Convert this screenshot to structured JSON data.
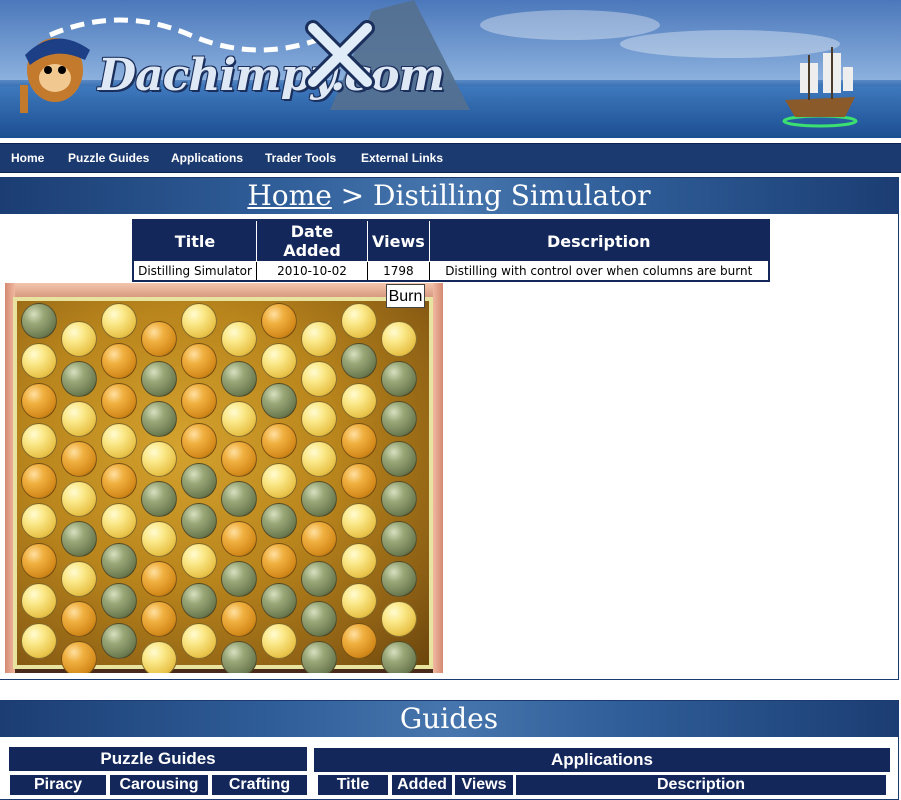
{
  "site": {
    "logo_text": "Dachimpy.com"
  },
  "nav": {
    "items": [
      "Home",
      "Puzzle Guides",
      "Applications",
      "Trader Tools",
      "External Links"
    ]
  },
  "page": {
    "breadcrumb_home": "Home",
    "breadcrumb_sep": " > ",
    "breadcrumb_current": "Distilling Simulator"
  },
  "info_table": {
    "headers": [
      "Title",
      "Date Added",
      "Views",
      "Description"
    ],
    "row": [
      "Distilling Simulator",
      "2010-10-02",
      "1798",
      "Distilling with control over when columns are burnt"
    ]
  },
  "game": {
    "burn_label": "Burn",
    "grid": [
      [
        "green",
        "yellow",
        "yellow",
        "orange",
        "yellow",
        "yellow",
        "orange",
        "yellow",
        "yellow",
        "yellow"
      ],
      [
        "yellow",
        "green",
        "orange",
        "green",
        "orange",
        "green",
        "yellow",
        "yellow",
        "green",
        "green"
      ],
      [
        "orange",
        "yellow",
        "orange",
        "green",
        "orange",
        "yellow",
        "green",
        "yellow",
        "yellow",
        "green"
      ],
      [
        "yellow",
        "orange",
        "yellow",
        "yellow",
        "orange",
        "orange",
        "orange",
        "yellow",
        "orange",
        "green"
      ],
      [
        "orange",
        "yellow",
        "orange",
        "green",
        "green",
        "green",
        "yellow",
        "green",
        "orange",
        "green"
      ],
      [
        "yellow",
        "green",
        "yellow",
        "yellow",
        "green",
        "orange",
        "green",
        "orange",
        "yellow",
        "green"
      ],
      [
        "orange",
        "yellow",
        "green",
        "orange",
        "yellow",
        "green",
        "orange",
        "green",
        "yellow",
        "green"
      ],
      [
        "yellow",
        "orange",
        "green",
        "orange",
        "green",
        "orange",
        "green",
        "green",
        "yellow",
        "yellow"
      ],
      [
        "yellow",
        "orange",
        "green",
        "yellow",
        "yellow",
        "green",
        "yellow",
        "green",
        "orange",
        "green"
      ]
    ]
  },
  "guides": {
    "title": "Guides",
    "puzzle_guides_label": "Puzzle Guides",
    "applications_label": "Applications",
    "puzzle_tabs": [
      "Piracy",
      "Carousing",
      "Crafting"
    ],
    "app_columns": [
      "Title",
      "Added",
      "Views",
      "Description"
    ]
  },
  "colors": {
    "nav_bg": "#1b3a6f",
    "header_dark": "#13275a"
  }
}
